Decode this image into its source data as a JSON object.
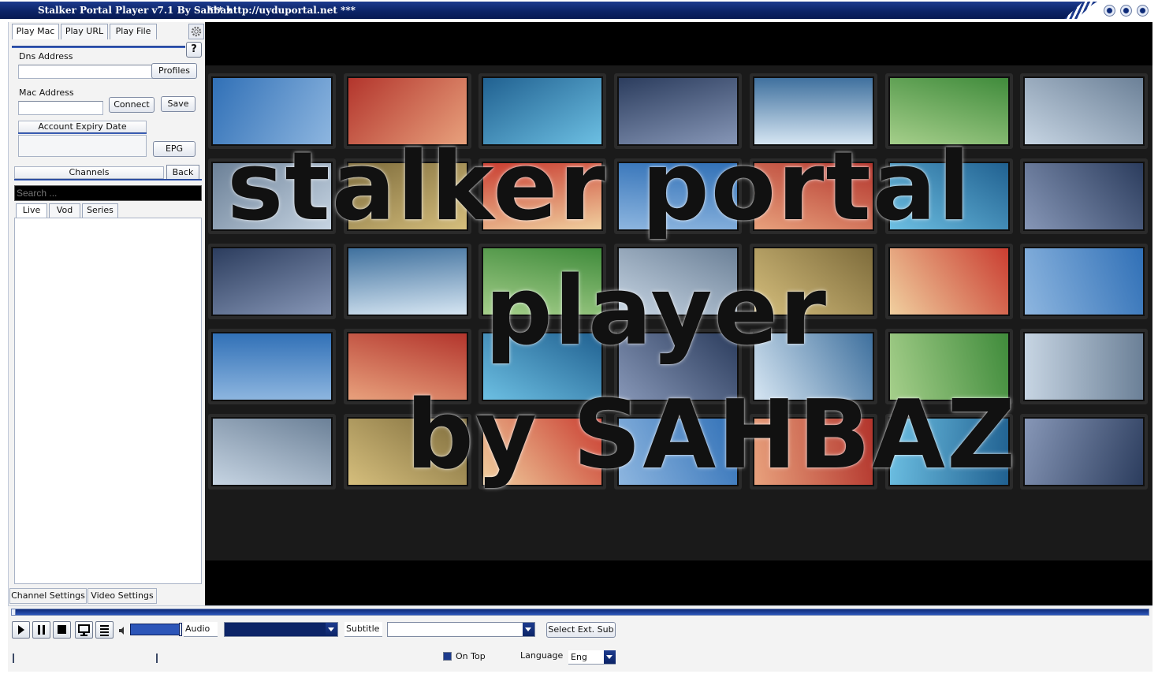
{
  "window": {
    "title": "Stalker Portal Player v7.1 By Sahbaz",
    "url_text": "*** http://uyduportal.net ***",
    "accent": "#0c2467"
  },
  "tabs": {
    "play_mac": "Play Mac",
    "play_url": "Play URL",
    "play_file": "Play File",
    "settings_icon": "gear-icon",
    "help": "?"
  },
  "connection": {
    "dns_label": "Dns Address",
    "dns_value": "",
    "profiles_button": "Profiles",
    "mac_label": "Mac Address",
    "mac_value": "",
    "connect_button": "Connect",
    "save_button": "Save",
    "expiry_label": "Account Expiry Date",
    "expiry_value": "",
    "epg_button": "EPG"
  },
  "channels": {
    "header": "Channels",
    "back_button": "Back",
    "search_placeholder": "Search ...",
    "tabs": [
      "Live",
      "Vod",
      "Series"
    ]
  },
  "bottom_tabs": {
    "channel_settings": "Channel Settings",
    "video_settings": "Video Settings"
  },
  "video": {
    "logo_line1": "stalker portal",
    "logo_line2": "player",
    "logo_line3": "by SAHBAZ"
  },
  "controls": {
    "audio_label": "Audio",
    "audio_value": "",
    "subtitle_label": "Subtitle",
    "subtitle_value": "",
    "select_sub_button": "Select Ext. Sub",
    "on_top_label": "On Top",
    "on_top_checked": true,
    "language_label": "Language",
    "language_value": "Eng",
    "volume_level": 1.0,
    "seek_position": 0.0
  }
}
